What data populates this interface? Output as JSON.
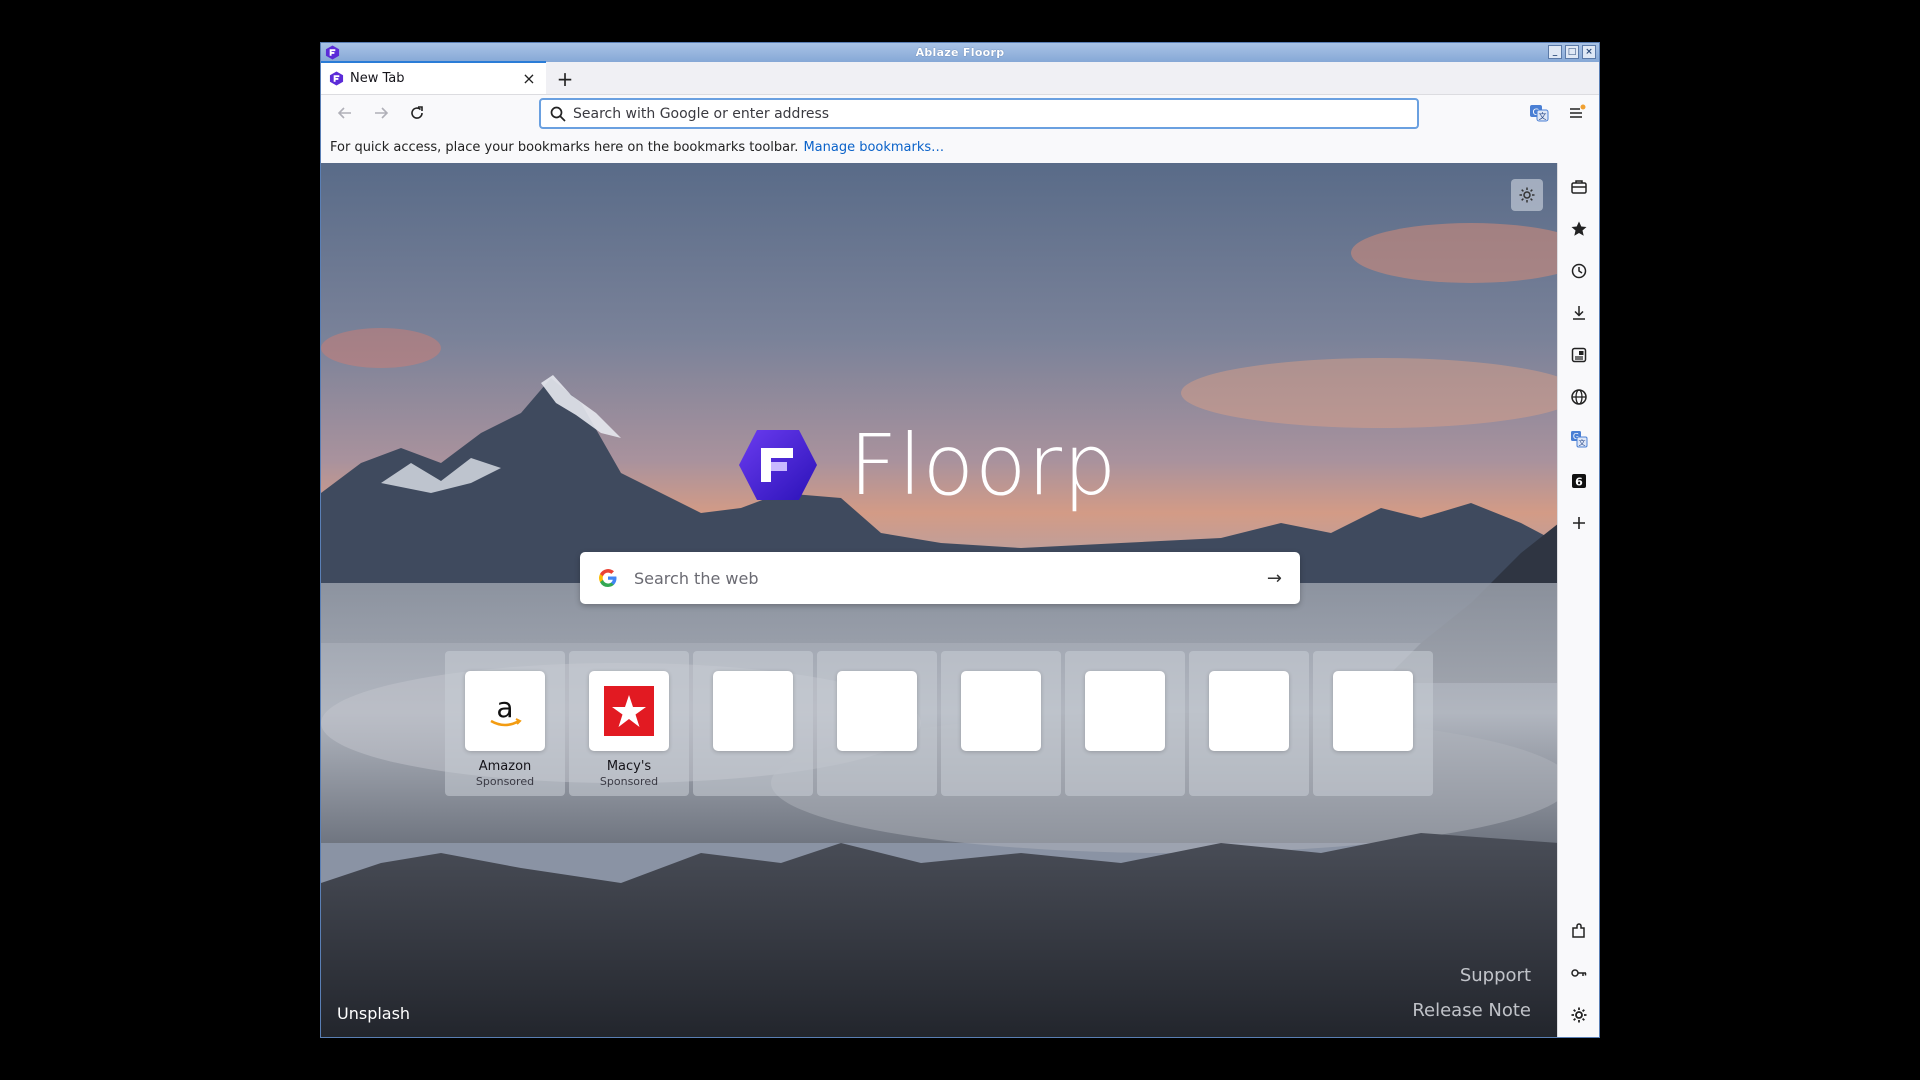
{
  "window": {
    "title": "Ablaze Floorp"
  },
  "tab": {
    "title": "New Tab"
  },
  "urlbar": {
    "placeholder": "Search with Google or enter address"
  },
  "bookmarks_bar": {
    "message": "For quick access, place your bookmarks here on the bookmarks toolbar.",
    "link": "Manage bookmarks…"
  },
  "newtab": {
    "logo_text": "Floorp",
    "search_placeholder": "Search the web",
    "tiles": [
      {
        "label": "Amazon",
        "sub": "Sponsored",
        "icon": "amazon-icon"
      },
      {
        "label": "Macy's",
        "sub": "Sponsored",
        "icon": "macys-icon"
      },
      {
        "label": "",
        "sub": ""
      },
      {
        "label": "",
        "sub": ""
      },
      {
        "label": "",
        "sub": ""
      },
      {
        "label": "",
        "sub": ""
      },
      {
        "label": "",
        "sub": ""
      },
      {
        "label": "",
        "sub": ""
      }
    ],
    "credit": "Unsplash",
    "support": "Support",
    "release_note": "Release Note"
  },
  "sidebar": {
    "top_items": [
      "briefcase-icon",
      "bookmark-star-icon",
      "history-icon",
      "download-icon",
      "notes-icon",
      "globe-icon",
      "translate-icon",
      "sixth-icon",
      "add-icon"
    ],
    "bottom_items": [
      "extensions-icon",
      "key-icon",
      "settings-icon"
    ]
  },
  "colors": {
    "accent": "#2a7cd7",
    "link": "#0a62c9",
    "titlebar": "#86a8d6"
  }
}
